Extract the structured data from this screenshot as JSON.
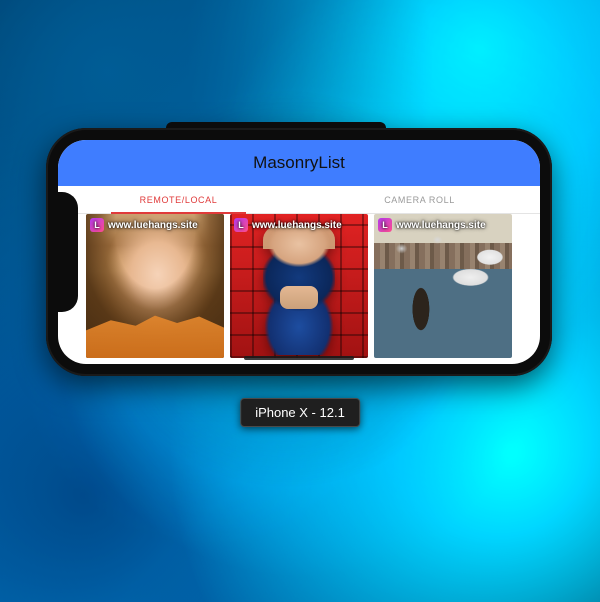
{
  "app": {
    "title": "MasonryList"
  },
  "tabs": [
    {
      "label": "REMOTE/LOCAL",
      "active": true
    },
    {
      "label": "CAMERA ROLL",
      "active": false
    }
  ],
  "gallery": {
    "items": [
      {
        "watermark": "www.luehangs.site"
      },
      {
        "watermark": "www.luehangs.site"
      },
      {
        "watermark": "www.luehangs.site"
      }
    ]
  },
  "device_caption": "iPhone X - 12.1"
}
